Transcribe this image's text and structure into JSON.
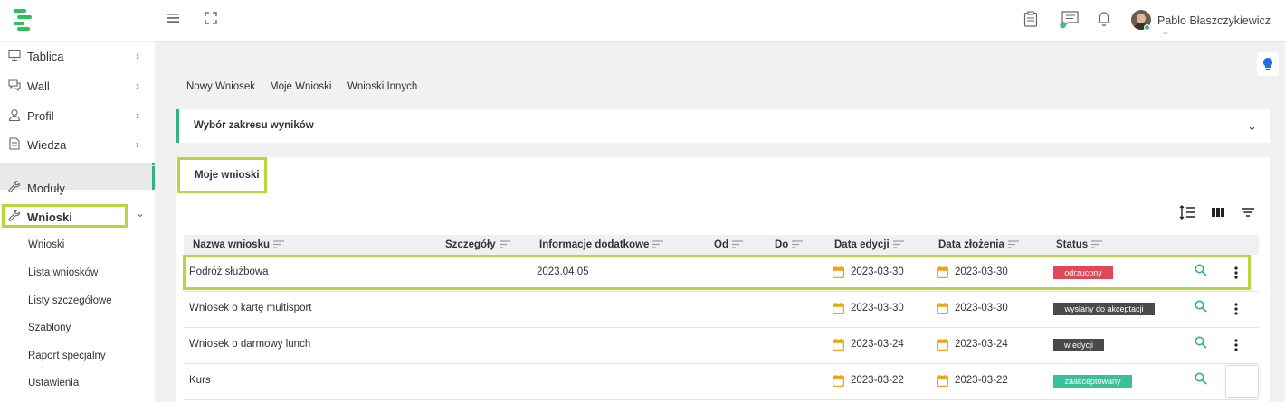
{
  "header": {
    "user_name": "Pablo Błaszczykiewicz",
    "user_chevron": "⌄"
  },
  "sidebar": {
    "items": [
      {
        "label": "Tablica",
        "icon": "monitor-icon"
      },
      {
        "label": "Wall",
        "icon": "chat-icon"
      },
      {
        "label": "Profil",
        "icon": "user-icon"
      },
      {
        "label": "Wiedza",
        "icon": "document-icon"
      },
      {
        "label": "Moduły",
        "icon": "wrench-icon"
      },
      {
        "label": "Wnioski",
        "icon": "wrench-icon"
      }
    ],
    "chevron_right": "›",
    "chevron_down": "⌄",
    "sub_items": [
      "Wnioski",
      "Lista wniosków",
      "Listy szczegółowe",
      "Szablony",
      "Raport specjalny",
      "Ustawienia"
    ]
  },
  "top_tabs": [
    "Nowy Wniosek",
    "Moje Wnioski",
    "Wnioski Innych"
  ],
  "range_panel": {
    "title": "Wybór zakresu wyników",
    "chevron": "⌄"
  },
  "section_tab": "Moje wnioski",
  "table": {
    "columns": [
      "Nazwa wniosku",
      "Szczegóły",
      "Informacje dodatkowe",
      "Od",
      "Do",
      "Data edycji",
      "Data złożenia",
      "Status"
    ],
    "rows": [
      {
        "name": "Podróż służbowa",
        "info": "2023.04.05",
        "edited": "2023-03-30",
        "submitted": "2023-03-30",
        "status": "odrzucony"
      },
      {
        "name": "Wniosek o kartę multisport",
        "info": "",
        "edited": "2023-03-30",
        "submitted": "2023-03-30",
        "status": "wysłany do akceptacji"
      },
      {
        "name": "Wniosek o darmowy lunch",
        "info": "",
        "edited": "2023-03-24",
        "submitted": "2023-03-24",
        "status": "w edycji"
      },
      {
        "name": "Kurs",
        "info": "",
        "edited": "2023-03-22",
        "submitted": "2023-03-22",
        "status": "zaakceptowany"
      }
    ]
  },
  "colors": {
    "accent": "#34b47a",
    "highlight": "#b5d93c",
    "status_rejected": "#e0485a",
    "status_sent": "#4a4a4a",
    "status_edit": "#4a4a4a",
    "status_accepted": "#3bbf99",
    "calendar": "#f0a419"
  }
}
